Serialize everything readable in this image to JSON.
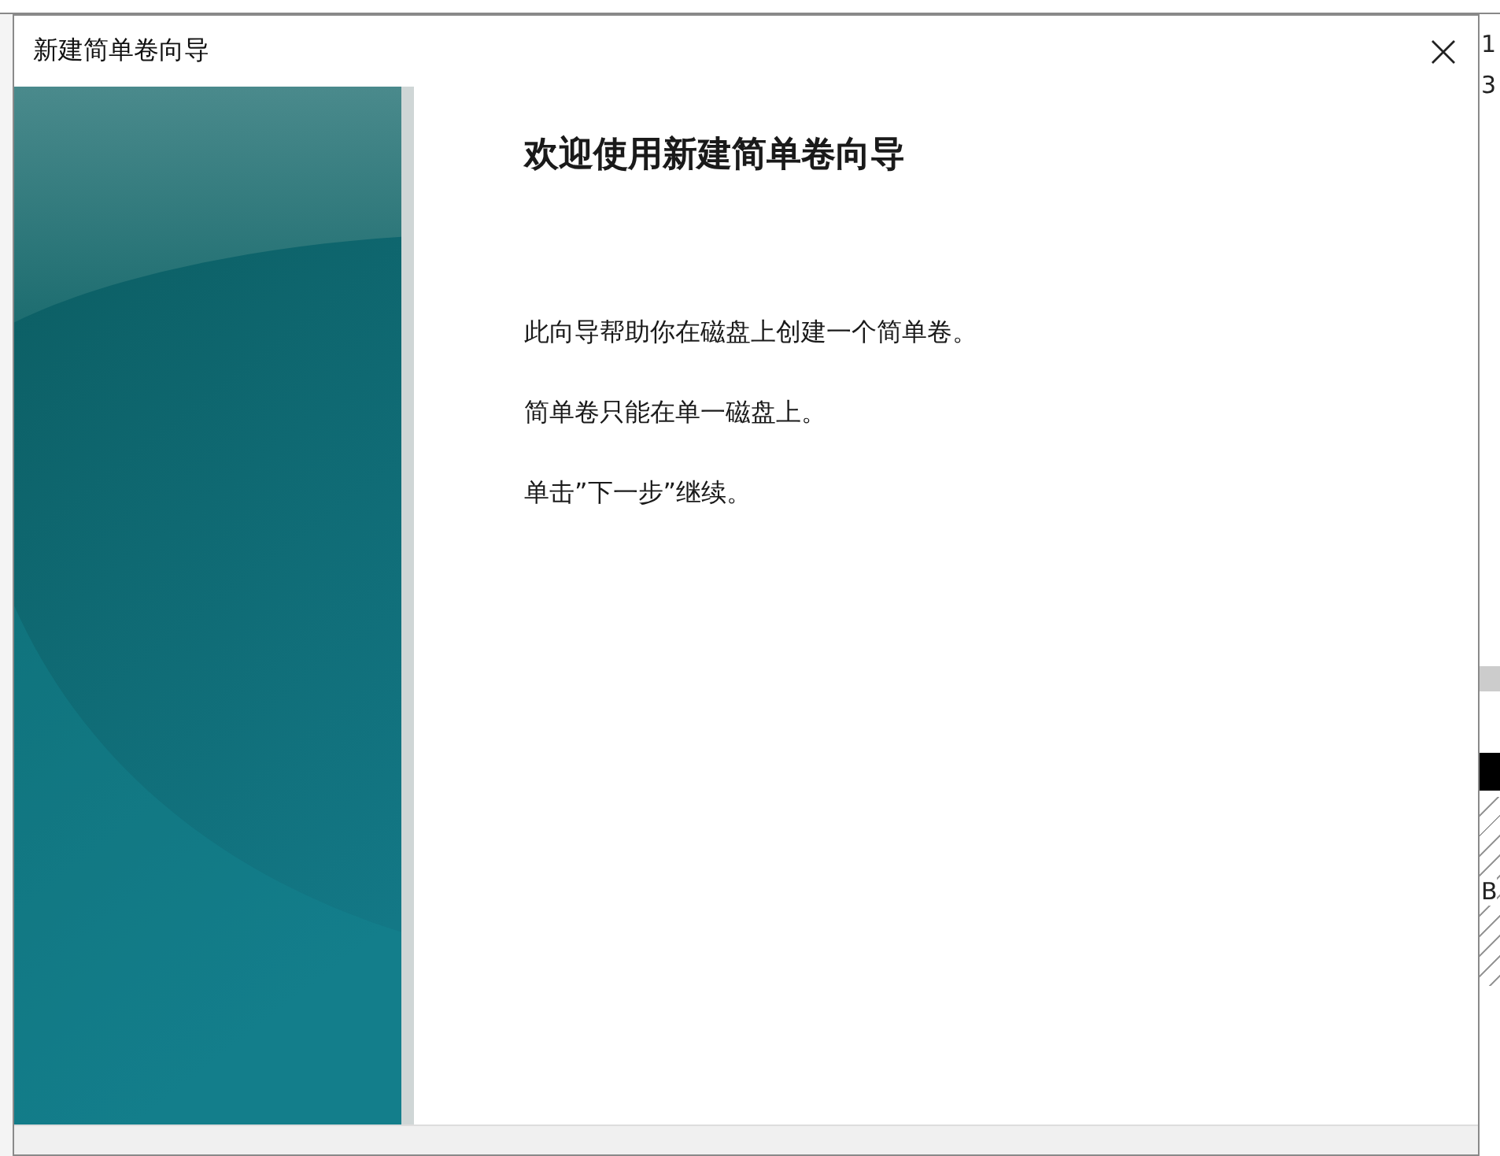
{
  "window": {
    "title": "新建简单卷向导"
  },
  "wizard": {
    "heading": "欢迎使用新建简单卷向导",
    "paragraphs": [
      "此向导帮助你在磁盘上创建一个简单卷。",
      "简单卷只能在单一磁盘上。",
      "单击”下一步”继续。"
    ]
  },
  "background_window": {
    "right_edge_texts": [
      "1",
      "3",
      "B"
    ]
  }
}
